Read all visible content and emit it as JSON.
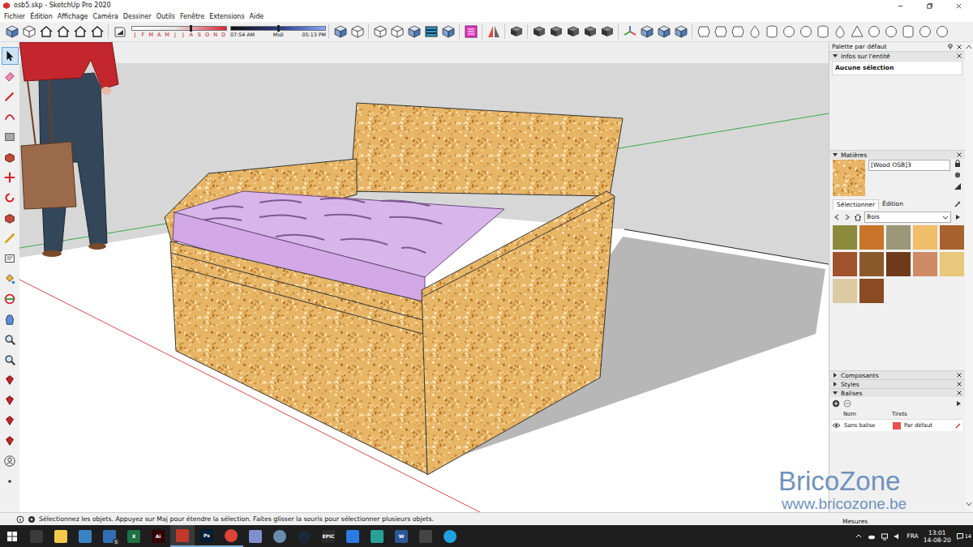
{
  "window": {
    "title": "osb5.skp - SketchUp Pro 2020"
  },
  "menu": [
    "Fichier",
    "Édition",
    "Affichage",
    "Caméra",
    "Dessiner",
    "Outils",
    "Fenêtre",
    "Extensions",
    "Aide"
  ],
  "shadow": {
    "months": [
      "J",
      "F",
      "M",
      "A",
      "M",
      "J",
      "J",
      "A",
      "S",
      "O",
      "N",
      "D"
    ],
    "date_level": 0.62,
    "time_start": "07:54 AM",
    "time_mid": "Midi",
    "time_end": "05:13 PM",
    "time_level": 0.5
  },
  "left_tools": [
    {
      "selected": true
    },
    {
      "selected": false
    },
    {
      "selected": false
    },
    {
      "selected": false
    },
    {
      "selected": false
    },
    {
      "selected": false
    },
    {
      "selected": false
    },
    {
      "selected": false
    },
    {
      "selected": false
    },
    {
      "selected": false
    },
    {
      "selected": false
    },
    {
      "selected": false
    },
    {
      "selected": false
    },
    {
      "selected": false
    },
    {
      "selected": false
    },
    {
      "selected": false
    },
    {
      "selected": false
    },
    {
      "selected": false
    },
    {
      "selected": false
    },
    {
      "selected": false
    },
    {
      "selected": false
    },
    {
      "selected": false
    }
  ],
  "tray": {
    "title": "Palette par défaut",
    "entity_info": {
      "title": "Infos sur l'entité",
      "expanded": true,
      "text": "Aucune sélection"
    },
    "materials": {
      "title": "Matières",
      "expanded": true,
      "name": "[Wood OSB]3",
      "tabs": [
        {
          "label": "Sélectionner",
          "selected": true
        },
        {
          "label": "Édition",
          "selected": false
        }
      ],
      "library": "Bois",
      "swatches": [
        {
          "color": "#8c8a3c"
        },
        {
          "color": "#c8742a"
        },
        {
          "color": "#9a9878"
        },
        {
          "color": "#f0bd68"
        },
        {
          "color": "#a8622e"
        },
        {
          "color": "#a0522d"
        },
        {
          "color": "#8b5a2b"
        },
        {
          "color": "#6e3b1a"
        },
        {
          "color": "#cf8a66"
        },
        {
          "color": "#e8c87a"
        },
        {
          "color": "#dccaa2"
        },
        {
          "color": "#8a4a22"
        }
      ]
    },
    "collapsed_panels": [
      {
        "title": "Composants",
        "expanded": false
      },
      {
        "title": "Styles",
        "expanded": false
      }
    ],
    "tags": {
      "title": "Balises",
      "expanded": true,
      "columns": [
        "Nom",
        "Tirets"
      ],
      "rows": [
        {
          "name": "Sans balise",
          "visible": true,
          "color": "#e84f4f",
          "dashes": "Par défaut"
        }
      ]
    }
  },
  "status_bar": {
    "text": "Sélectionnez les objets. Appuyez sur Maj pour étendre la sélection. Faites glisser la souris pour sélectionner plusieurs objets.",
    "measurements_label": "Mesures"
  },
  "watermark": {
    "title": "BricoZone",
    "url": "www.bricozone.be"
  },
  "taskbar": {
    "apps": [
      {
        "label": "",
        "shape": "square",
        "color": "#3a3a3a",
        "running": false,
        "active": false,
        "badge": ""
      },
      {
        "label": "",
        "shape": "square",
        "color": "#f2c94c",
        "running": false,
        "active": false,
        "badge": ""
      },
      {
        "label": "",
        "shape": "square",
        "color": "#3b82c4",
        "running": false,
        "active": false,
        "badge": ""
      },
      {
        "label": "",
        "shape": "square",
        "color": "#2f6fb5",
        "running": false,
        "active": false,
        "badge": "5"
      },
      {
        "label": "X",
        "shape": "square",
        "color": "#1e7145",
        "running": false,
        "active": false,
        "badge": ""
      },
      {
        "label": "Ai",
        "shape": "square",
        "color": "#330000",
        "running": false,
        "active": false,
        "badge": ""
      },
      {
        "label": "",
        "shape": "square",
        "color": "#c0392b",
        "running": true,
        "active": true,
        "badge": ""
      },
      {
        "label": "Ps",
        "shape": "square",
        "color": "#001e36",
        "running": true,
        "active": false,
        "badge": ""
      },
      {
        "label": "",
        "shape": "circle",
        "color": "#db4437",
        "running": true,
        "active": false,
        "badge": ""
      },
      {
        "label": "",
        "shape": "square",
        "color": "#7f8fd0",
        "running": false,
        "active": false,
        "badge": ""
      },
      {
        "label": "",
        "shape": "circle",
        "color": "#6a8caf",
        "running": false,
        "active": false,
        "badge": ""
      },
      {
        "label": "",
        "shape": "circle",
        "color": "#1b2838",
        "running": false,
        "active": false,
        "badge": ""
      },
      {
        "label": "EPIC",
        "shape": "square",
        "color": "#2a2a2a",
        "running": false,
        "active": false,
        "badge": ""
      },
      {
        "label": "",
        "shape": "square",
        "color": "#2c7be5",
        "running": false,
        "active": false,
        "badge": ""
      },
      {
        "label": "",
        "shape": "square",
        "color": "#2aa198",
        "running": false,
        "active": false,
        "badge": ""
      },
      {
        "label": "W",
        "shape": "square",
        "color": "#2b579a",
        "running": false,
        "active": false,
        "badge": ""
      },
      {
        "label": "",
        "shape": "square",
        "color": "#444444",
        "running": false,
        "active": false,
        "badge": ""
      },
      {
        "label": "",
        "shape": "circle",
        "color": "#1fa0e0",
        "running": false,
        "active": false,
        "badge": ""
      }
    ],
    "language": "FRA",
    "time": "13:01",
    "date": "14-08-20",
    "notifications": "14"
  }
}
